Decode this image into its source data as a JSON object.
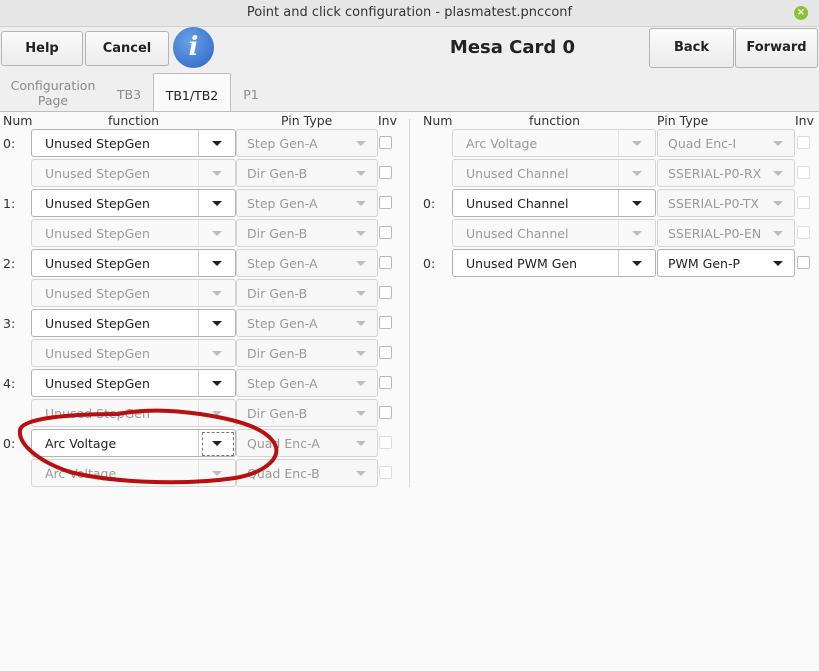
{
  "window": {
    "title": "Point and click configuration - plasmatest.pncconf",
    "close_symbol": "×"
  },
  "toolbar": {
    "help_label": "Help",
    "cancel_label": "Cancel",
    "info_symbol": "i",
    "card_title": "Mesa Card 0",
    "back_label": "Back",
    "forward_label": "Forward"
  },
  "tabs": [
    {
      "label": "Configuration\nPage"
    },
    {
      "label": "TB3"
    },
    {
      "label": "TB1/TB2"
    },
    {
      "label": "P1"
    }
  ],
  "headers": {
    "num": "Num",
    "function": "function",
    "pin_type": "Pin Type",
    "inv": "Inv"
  },
  "left_rows": [
    {
      "num": "0:",
      "function": "Unused StepGen",
      "pin": "Step Gen-A",
      "fn_enabled": true
    },
    {
      "num": "",
      "function": "Unused StepGen",
      "pin": "Dir Gen-B",
      "fn_enabled": false
    },
    {
      "num": "1:",
      "function": "Unused StepGen",
      "pin": "Step Gen-A",
      "fn_enabled": true
    },
    {
      "num": "",
      "function": "Unused StepGen",
      "pin": "Dir Gen-B",
      "fn_enabled": false
    },
    {
      "num": "2:",
      "function": "Unused StepGen",
      "pin": "Step Gen-A",
      "fn_enabled": true
    },
    {
      "num": "",
      "function": "Unused StepGen",
      "pin": "Dir Gen-B",
      "fn_enabled": false
    },
    {
      "num": "3:",
      "function": "Unused StepGen",
      "pin": "Step Gen-A",
      "fn_enabled": true
    },
    {
      "num": "",
      "function": "Unused StepGen",
      "pin": "Dir Gen-B",
      "fn_enabled": false
    },
    {
      "num": "4:",
      "function": "Unused StepGen",
      "pin": "Step Gen-A",
      "fn_enabled": true
    },
    {
      "num": "",
      "function": "Unused StepGen",
      "pin": "Dir Gen-B",
      "fn_enabled": false
    },
    {
      "num": "0:",
      "function": "Arc Voltage",
      "pin": "Quad Enc-A",
      "fn_enabled": true
    },
    {
      "num": "",
      "function": "Arc Voltage",
      "pin": "Quad Enc-B",
      "fn_enabled": false
    }
  ],
  "right_rows": [
    {
      "num": "",
      "function": "Arc Voltage",
      "pin": "Quad Enc-I",
      "fn_enabled": false,
      "pin_enabled": false
    },
    {
      "num": "",
      "function": "Unused Channel",
      "pin": "SSERIAL-P0-RX",
      "fn_enabled": false,
      "pin_enabled": false
    },
    {
      "num": "0:",
      "function": "Unused Channel",
      "pin": "SSERIAL-P0-TX",
      "fn_enabled": true,
      "pin_enabled": false
    },
    {
      "num": "",
      "function": "Unused Channel",
      "pin": "SSERIAL-P0-EN",
      "fn_enabled": false,
      "pin_enabled": false
    },
    {
      "num": "0:",
      "function": "Unused PWM Gen",
      "pin": "PWM Gen-P",
      "fn_enabled": true,
      "pin_enabled": true
    }
  ],
  "annotation": {
    "color": "#b80f0f"
  }
}
